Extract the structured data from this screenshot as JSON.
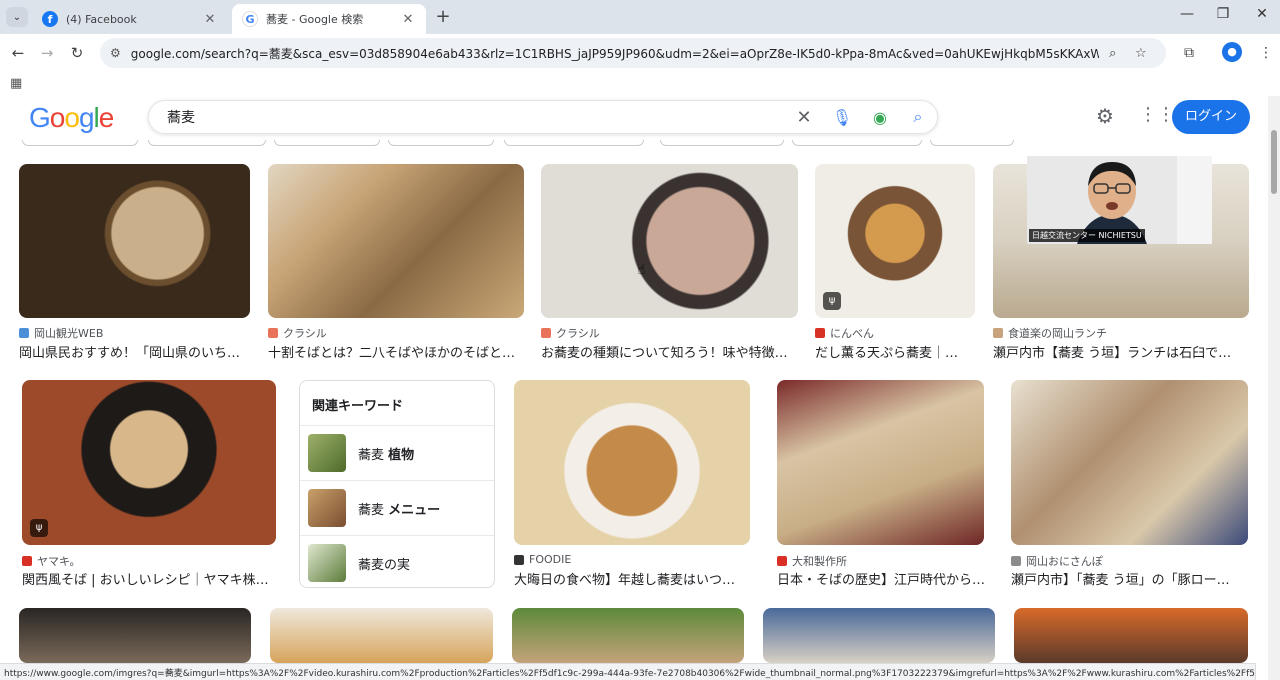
{
  "browser": {
    "tabs": [
      {
        "title": "(4) Facebook",
        "favicon": "facebook-icon"
      },
      {
        "title": "蕎麦 - Google 検索",
        "favicon": "google-icon",
        "active": true
      }
    ],
    "url": "google.com/search?q=蕎麦&sca_esv=03d858904e6ab433&rlz=1C1RBHS_jaJP959JP960&udm=2&ei=aOprZ8e-IK5d0-kPpa-8mAc&ved=0ahUKEwjHkqbM5sKKAxWkzjQHHaUXD3MQ4dUD...",
    "status_url": "https://www.google.com/imgres?q=蕎麦&imgurl=https%3A%2F%2Fvideo.kurashiru.com%2Fproduction%2Farticles%2Ff5df1c9c-299a-444a-93fe-7e2708b40306%2Fwide_thumbnail_normal.png%3F1703222379&imgrefurl=https%3A%2F%2Fwww.kurashiru.com%2Farticles%2Ff5df1c..."
  },
  "google": {
    "query": "蕎麦",
    "login_label": "ログイン",
    "logo_letters": [
      "G",
      "o",
      "o",
      "g",
      "l",
      "e"
    ],
    "logo_colors": [
      "#4285f4",
      "#ea4335",
      "#fbbc05",
      "#4285f4",
      "#34a853",
      "#ea4335"
    ]
  },
  "results_row1": [
    {
      "source": "岡山観光WEB",
      "title": "岡山県民おすすめ！「岡山県のいち…",
      "icon_color": "#4a90d9"
    },
    {
      "source": "クラシル",
      "title": "十割そばとは？二八そばやほかのそばと…",
      "icon_color": "#e8735a"
    },
    {
      "source": "クラシル",
      "title": "お蕎麦の種類について知ろう！味や特徴…",
      "icon_color": "#e8735a"
    },
    {
      "source": "にんべん",
      "title": "だし薫る天ぷら蕎麦｜…",
      "icon_color": "#d93025"
    },
    {
      "source": "食道楽の岡山ランチ",
      "title": "瀬戸内市【蕎麦 う垣】ランチは石臼で…",
      "icon_color": "#c7a27a"
    }
  ],
  "results_row2": [
    {
      "source": "ヤマキ。",
      "title": "関西風そば | おいしいレシピ｜ヤマキ株…",
      "icon_color": "#d93025"
    },
    {
      "source": "FOODIE",
      "title": "大晦日の食べ物】年越し蕎麦はいつ…",
      "icon_color": "#333333"
    },
    {
      "source": "大和製作所",
      "title": "日本・そばの歴史】江戸時代から…",
      "icon_color": "#d93025"
    },
    {
      "source": "岡山おにさんぽ",
      "title": "瀬戸内市】「蕎麦 う垣」の「豚ロー…",
      "icon_color": "#8c8c8c"
    }
  ],
  "related": {
    "heading": "関連キーワード",
    "items": [
      {
        "prefix": "蕎麦 ",
        "bold": "植物"
      },
      {
        "prefix": "蕎麦 ",
        "bold": "メニュー"
      },
      {
        "prefix": "蕎麦の実",
        "bold": ""
      }
    ]
  },
  "video_overlay": {
    "label": "日越交流センター NICHIETSU"
  }
}
